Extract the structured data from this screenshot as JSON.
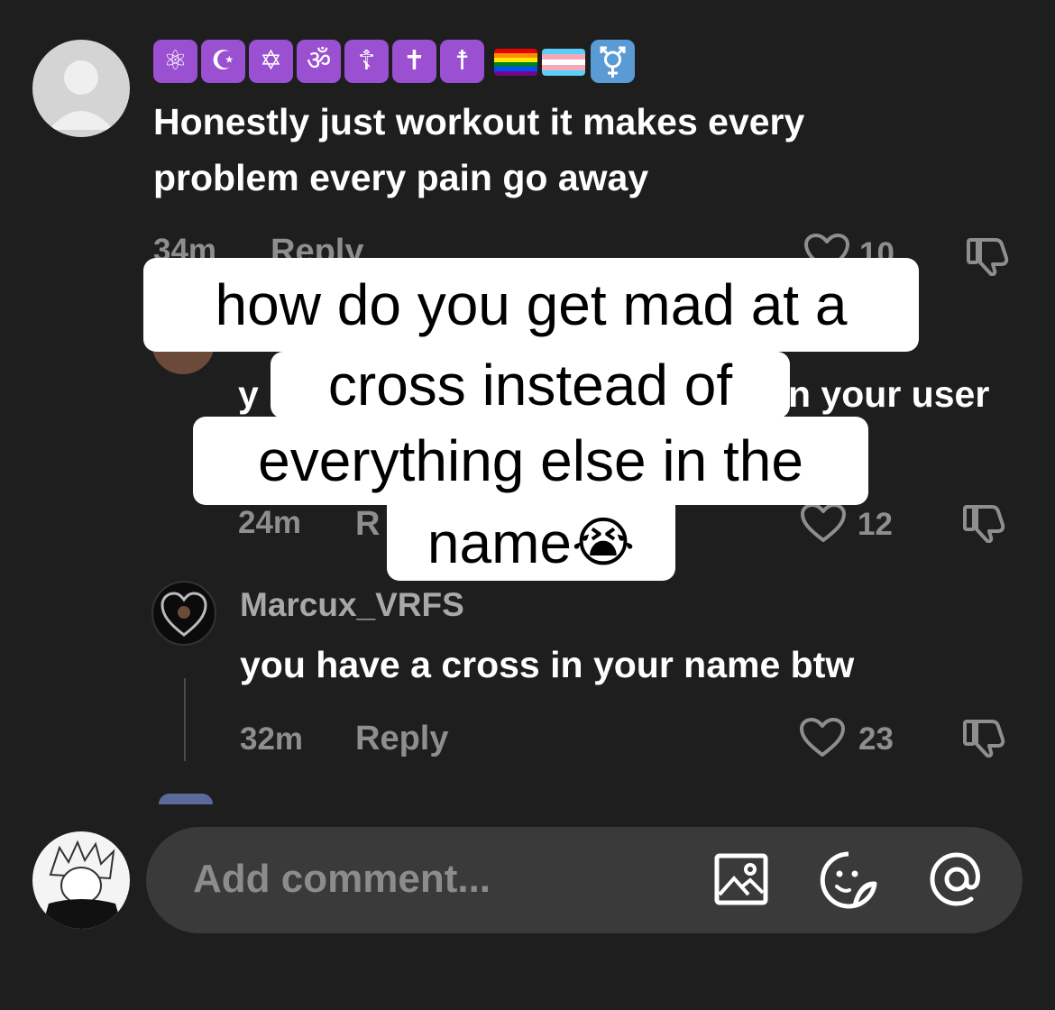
{
  "comments": [
    {
      "username_badges": [
        "⚛",
        "☪",
        "✡",
        "ॐ",
        "☦",
        "✝",
        "☨"
      ],
      "text": "Honestly just workout it makes every problem every pain go away",
      "time": "34m",
      "reply_label": "Reply",
      "likes": "10"
    },
    {
      "text_left": "y",
      "text_right": "n your user",
      "time": "24m",
      "reply_label": "R",
      "likes": "12"
    },
    {
      "username": "Marcux_VRFS",
      "text": "you have a cross in your name btw",
      "time": "32m",
      "reply_label": "Reply",
      "likes": "23"
    }
  ],
  "caption": {
    "lines": [
      "how do you get mad at a",
      "cross instead of",
      "everything else in the",
      "name"
    ],
    "emoji": "😭"
  },
  "composer": {
    "placeholder": "Add comment...",
    "icons": [
      "image-icon",
      "sticker-icon",
      "mention-icon"
    ]
  },
  "colors": {
    "background": "#1e1e1e",
    "badge_purple": "#9b4fd1",
    "muted_text": "#8e8e8e",
    "input_bg": "#3a3a3a"
  }
}
